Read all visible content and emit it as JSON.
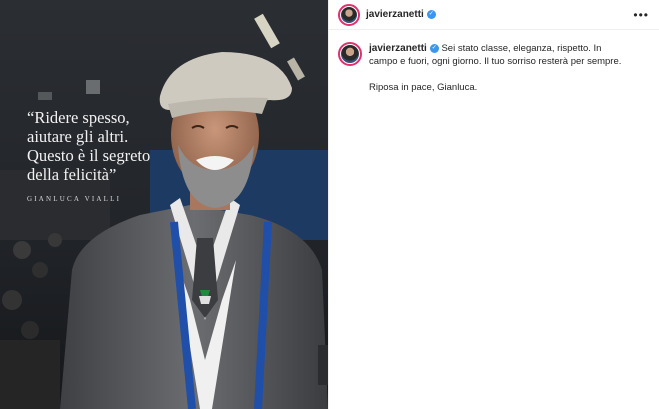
{
  "post": {
    "quote_text": "“Ridere spesso,\naiutare gli altri.\nQuesto è il segreto\ndella felicità”",
    "quote_author": "GIANLUCA VIALLI"
  },
  "header": {
    "username": "javierzanetti",
    "more_label": "•••"
  },
  "caption": {
    "username": "javierzanetti",
    "text": "Sei stato classe, eleganza, rispetto. In campo e fuori, ogni giorno. Il tuo sorriso resterà per sempre.",
    "second_paragraph": "Riposa in pace, Gianluca."
  },
  "icons": {
    "verified": "verified-badge-icon",
    "more": "more-options-icon"
  },
  "colors": {
    "verified_blue": "#3897f0",
    "story_ring": "#e1306c",
    "lanyard_blue": "#1f4fa8"
  }
}
